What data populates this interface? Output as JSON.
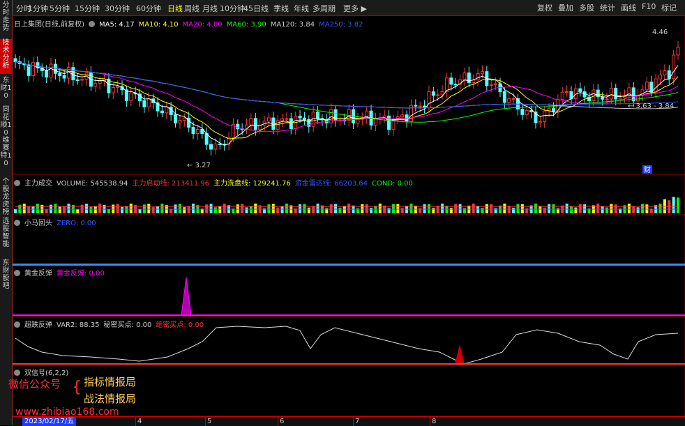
{
  "sidebar": {
    "tabs": [
      {
        "label": "分时走势",
        "active": false
      },
      {
        "label": "技术分析",
        "active": true
      },
      {
        "label": "东财10",
        "active": false
      },
      {
        "label": "同花顺10",
        "active": false
      },
      {
        "label": "维赛特10",
        "active": false
      },
      {
        "label": "个股龙虎榜",
        "active": false
      },
      {
        "label": "选股智能",
        "active": false
      },
      {
        "label": "东财股吧",
        "active": false
      }
    ]
  },
  "periods": [
    "分时",
    "1分钟",
    "5分钟",
    "15分钟",
    "30分钟",
    "60分钟",
    "日线",
    "周线",
    "月线",
    "10分钟",
    "45日线",
    "季线",
    "年线",
    "多周期",
    "更多"
  ],
  "active_period": "日线",
  "tools": [
    "复权",
    "叠加",
    "多股",
    "统计",
    "画线",
    "F10",
    "标记"
  ],
  "main_legend": {
    "title": "日上集团(日线,前复权)",
    "ma": [
      {
        "label": "MA5: 4.17",
        "color": "#ffffff"
      },
      {
        "label": "MA10: 4.10",
        "color": "#ffff00"
      },
      {
        "label": "MA20: 4.00",
        "color": "#ff00ff"
      },
      {
        "label": "MA60: 3.90",
        "color": "#00ff00"
      },
      {
        "label": "MA120: 3.84",
        "color": "#cccccc"
      },
      {
        "label": "MA250: 3.82",
        "color": "#3355ff"
      }
    ]
  },
  "price_annotations": {
    "high": "4.46",
    "low": "3.27",
    "range": "3.63 - 3.84",
    "marker": "财"
  },
  "volume_legend": [
    {
      "label": "主力成交",
      "color": "#cccccc"
    },
    {
      "label": "VOLUME: 545538.94",
      "color": "#cccccc"
    },
    {
      "label": "主力启动线: 213411.96",
      "color": "#ff3333"
    },
    {
      "label": "主力洗盘线: 129241.76",
      "color": "#ffff00"
    },
    {
      "label": "资金雷达线: 66203.64",
      "color": "#3355ff"
    },
    {
      "label": "COND: 0.00",
      "color": "#00ff00"
    }
  ],
  "xiaoma_legend": [
    {
      "label": "小马回头",
      "color": "#cccccc"
    },
    {
      "label": "ZERO: 0.00",
      "color": "#3355ff"
    }
  ],
  "huangjin_legend": [
    {
      "label": "黄金反弹",
      "color": "#cccccc"
    },
    {
      "label": "黄金反弹: 0.00",
      "color": "#ff00ff"
    }
  ],
  "chaodie_legend": [
    {
      "label": "超跌反弹",
      "color": "#cccccc"
    },
    {
      "label": "VAR2: 88.35",
      "color": "#cccccc"
    },
    {
      "label": "秘密买点: 0.00",
      "color": "#cccccc"
    },
    {
      "label": "绝密买点: 0.00",
      "color": "#ff3333"
    }
  ],
  "shuangxinhao_legend": [
    {
      "label": "双信号(6,2,2)",
      "color": "#cccccc"
    }
  ],
  "watermark": {
    "brand": "微信公众号",
    "line1": "指标情报局",
    "line2": "战法情报局",
    "site": "www.zhibiao168.com"
  },
  "x_axis": {
    "date_label": "2023/02/17/五",
    "months": [
      "4",
      "5",
      "6",
      "7",
      "8"
    ]
  }
}
